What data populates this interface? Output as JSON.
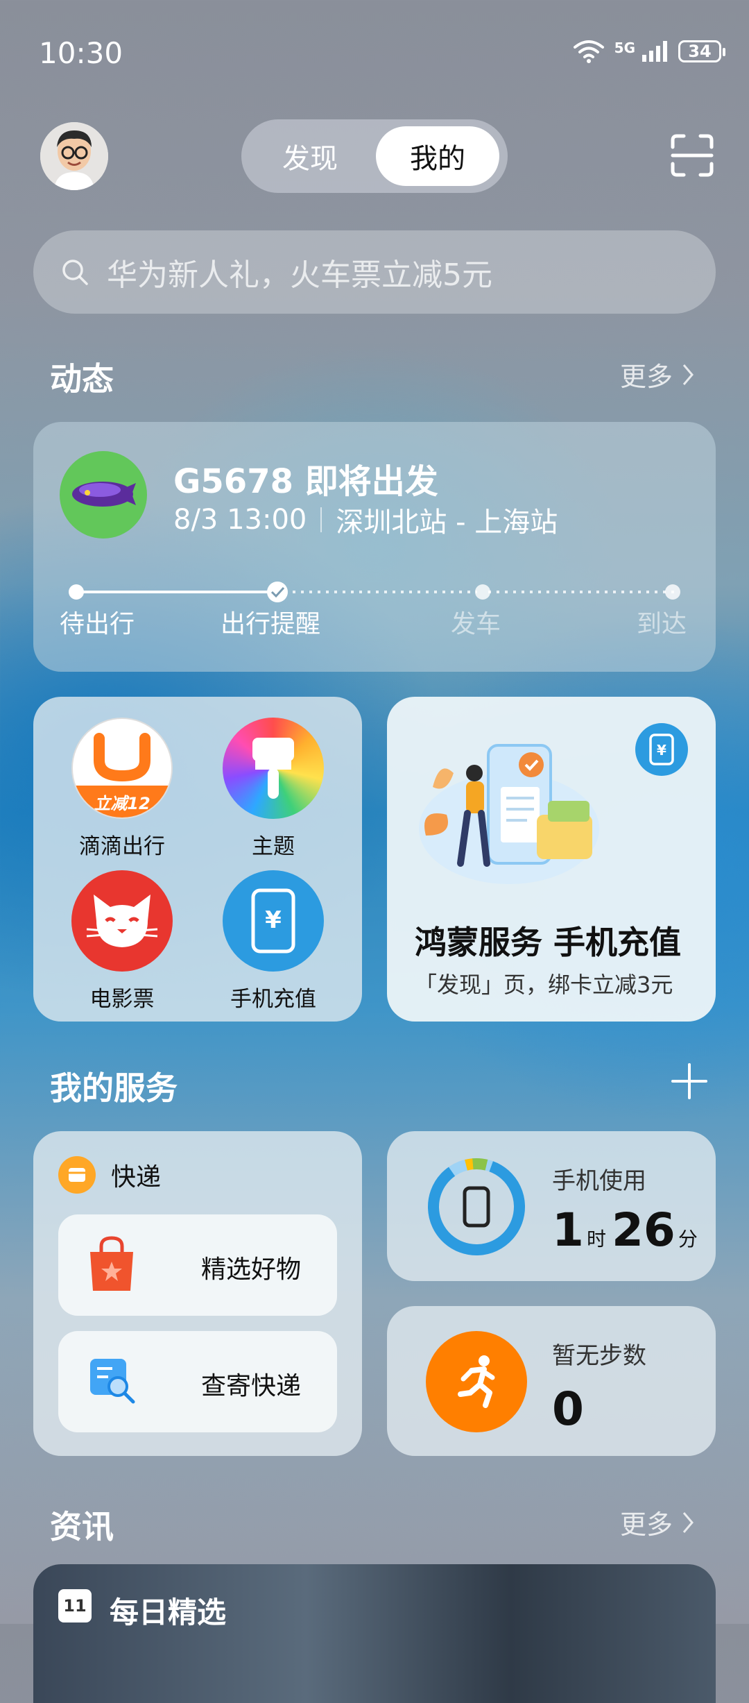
{
  "status": {
    "time": "10:30",
    "network": "5G",
    "battery": "34"
  },
  "header": {
    "tabs": [
      "发现",
      "我的"
    ],
    "active_tab": "我的"
  },
  "search": {
    "placeholder": "华为新人礼，火车票立减5元"
  },
  "dynamic": {
    "title": "动态",
    "more": "更多",
    "trip": {
      "title": "G5678 即将出发",
      "datetime": "8/3 13:00",
      "route": "深圳北站 - 上海站",
      "steps": [
        "待出行",
        "出行提醒",
        "发车",
        "到达"
      ],
      "current_step": 2
    }
  },
  "tiles": [
    {
      "label": "滴滴出行",
      "badge": "立减12",
      "icon": "didi-icon"
    },
    {
      "label": "主题",
      "icon": "theme-brush-icon"
    },
    {
      "label": "电影票",
      "icon": "movie-cat-icon"
    },
    {
      "label": "手机充值",
      "icon": "phone-recharge-icon"
    }
  ],
  "promo": {
    "title": "鸿蒙服务 手机充值",
    "subtitle": "「发现」页，绑卡立减3元",
    "badge_icon": "yuan-icon"
  },
  "services": {
    "title": "我的服务",
    "express": {
      "title": "快递",
      "items": [
        "精选好物",
        "查寄快递"
      ]
    },
    "usage": {
      "label": "手机使用",
      "hours": "1",
      "h_unit": "时",
      "minutes": "26",
      "m_unit": "分"
    },
    "steps": {
      "label": "暂无步数",
      "value": "0"
    }
  },
  "news": {
    "title": "资讯",
    "more": "更多",
    "card_badge": "11",
    "card_title": "每日精选"
  },
  "colors": {
    "accent": "#2c9be0",
    "didi": "#ff7a1a",
    "movie": "#e8362f",
    "steps": "#ff7f00",
    "trip_logo_bg": "#62c75a"
  }
}
